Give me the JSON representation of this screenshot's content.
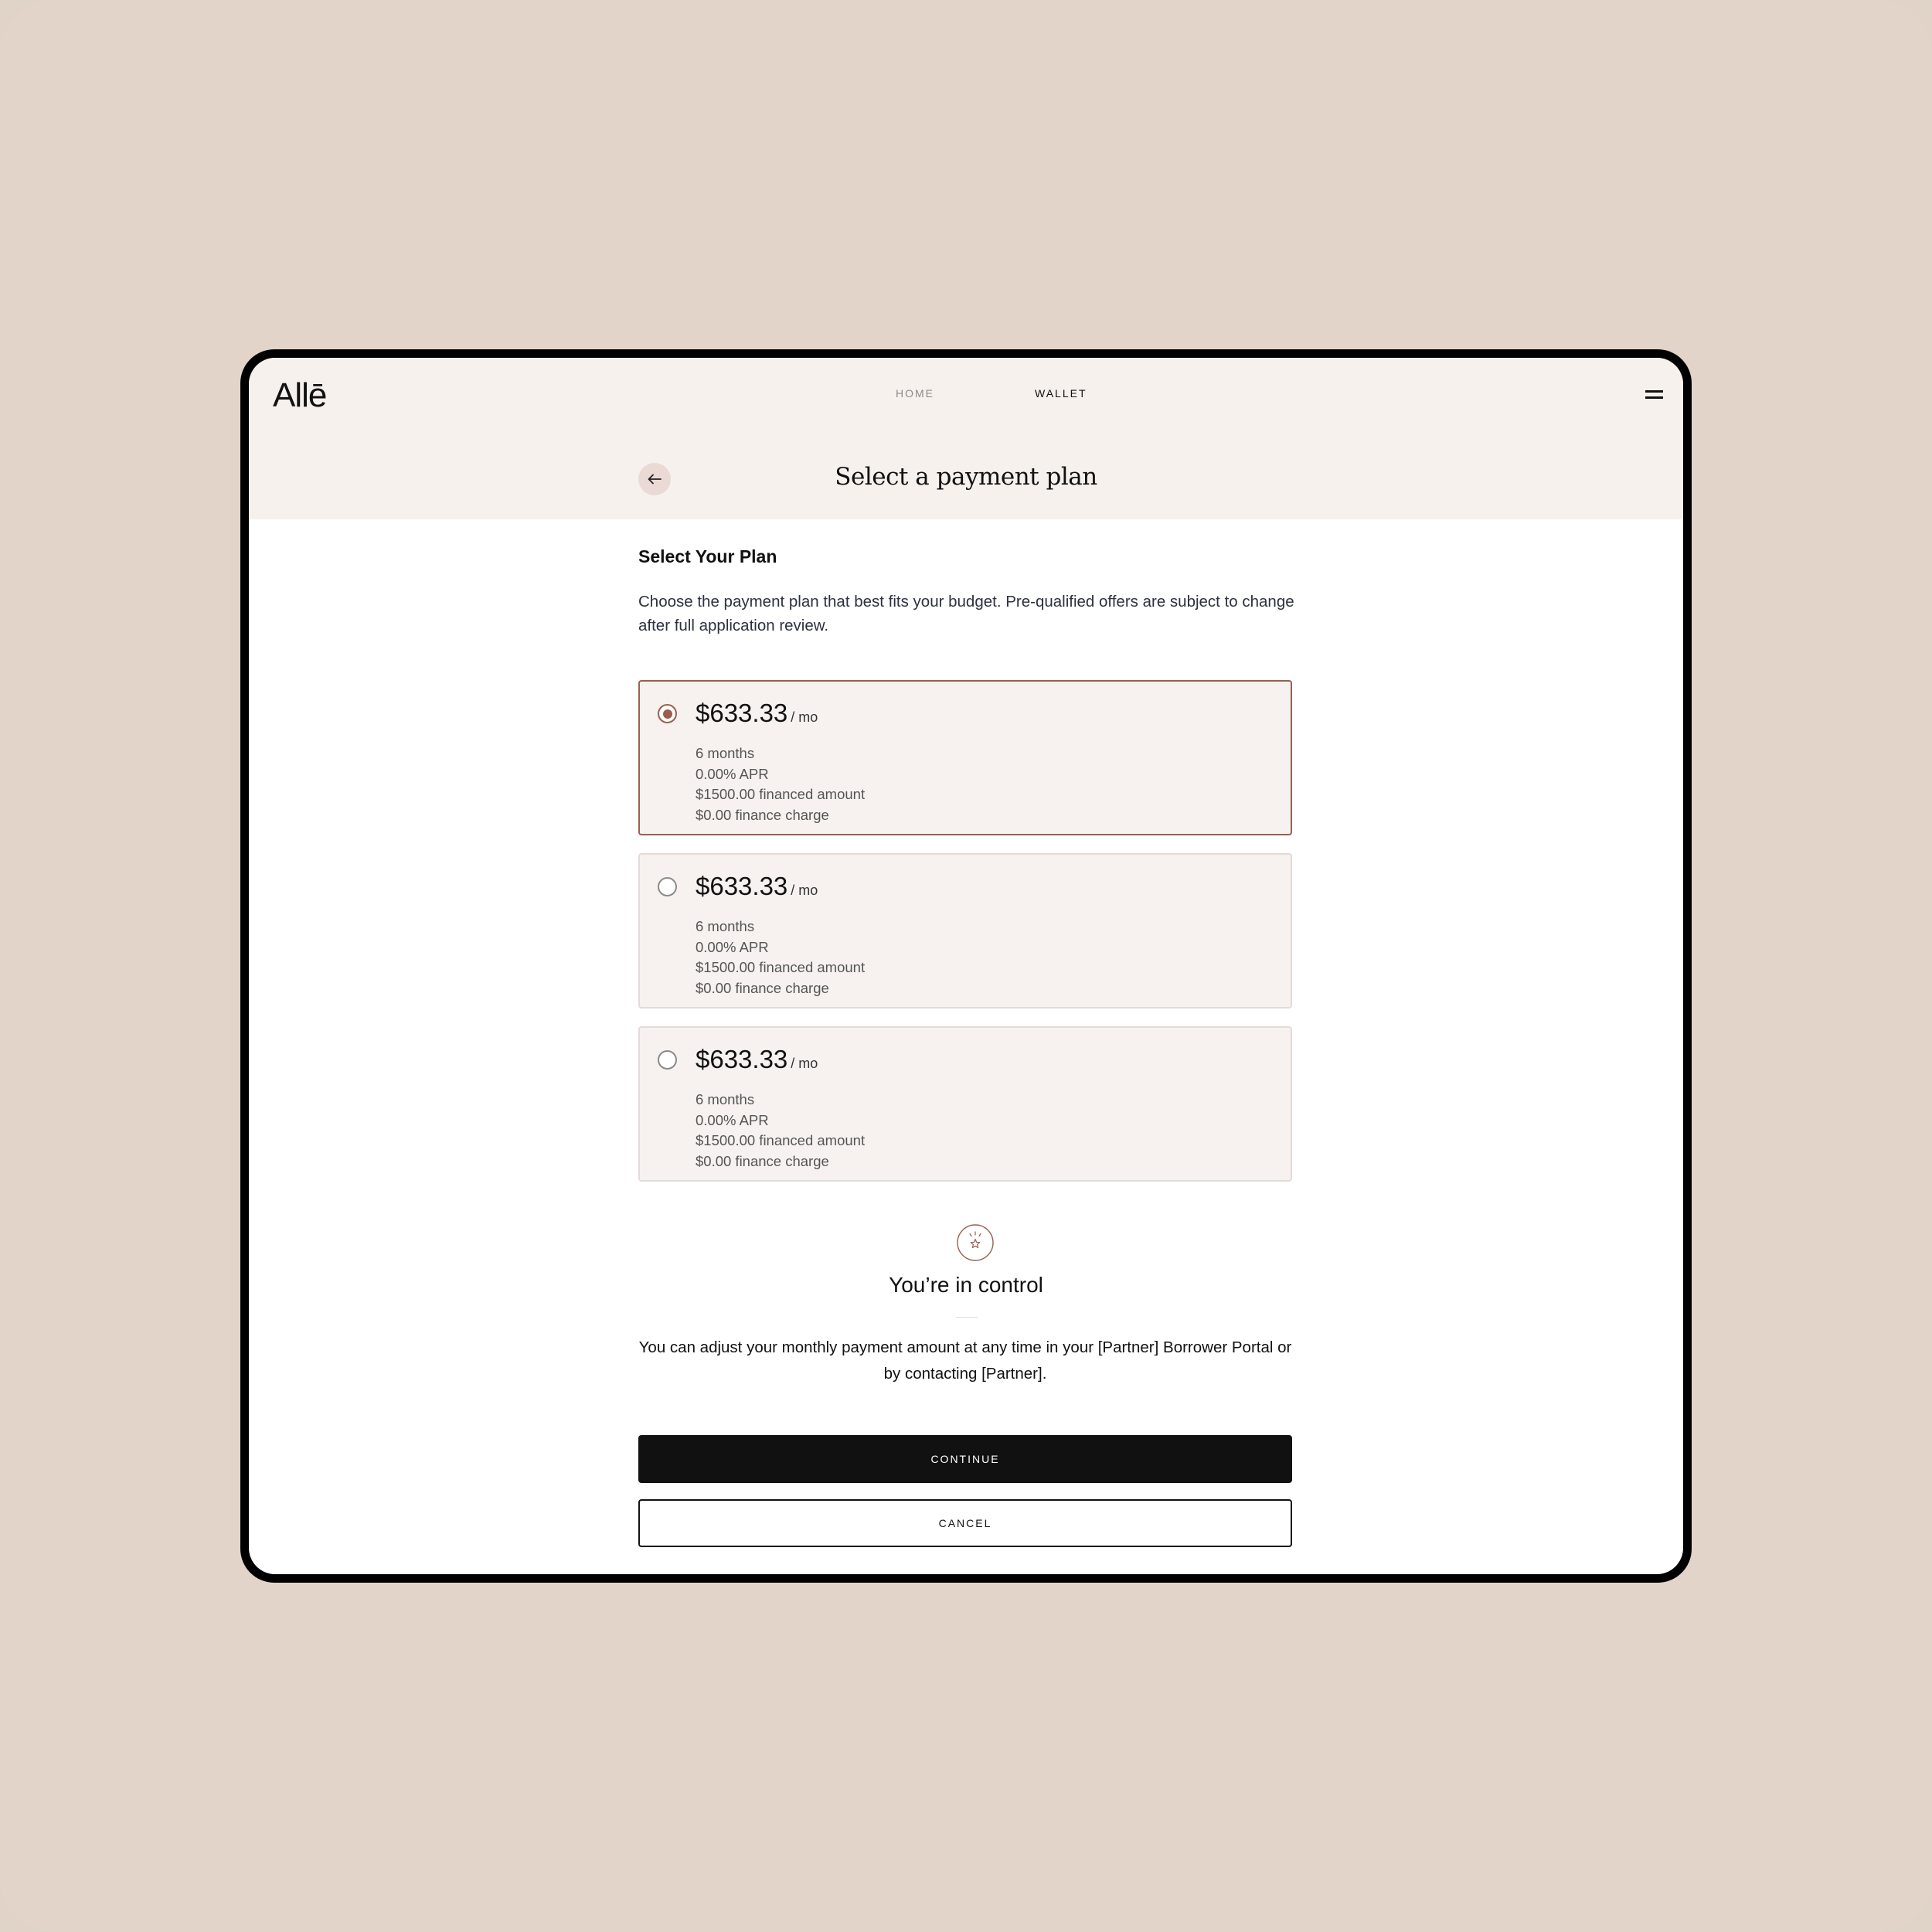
{
  "header": {
    "logo": "Allē",
    "nav": [
      {
        "label": "HOME"
      },
      {
        "label": "WALLET"
      }
    ],
    "menu_icon": "hamburger-icon"
  },
  "page": {
    "title": "Select a payment plan",
    "back_icon": "arrow-left-icon"
  },
  "plan_section": {
    "title": "Select Your Plan",
    "description": "Choose the payment plan that best fits your budget. Pre-qualified offers are subject to change after full application review.",
    "plans": [
      {
        "price": "$633.33",
        "unit": "/ mo",
        "term": "6 months",
        "apr": "0.00% APR",
        "financed": "$1500.00 financed amount",
        "charge": "$0.00 finance charge",
        "selected": true
      },
      {
        "price": "$633.33",
        "unit": "/ mo",
        "term": "6 months",
        "apr": "0.00% APR",
        "financed": "$1500.00 financed amount",
        "charge": "$0.00 finance charge",
        "selected": false
      },
      {
        "price": "$633.33",
        "unit": "/ mo",
        "term": "6 months",
        "apr": "0.00% APR",
        "financed": "$1500.00 financed amount",
        "charge": "$0.00 finance charge",
        "selected": false
      }
    ]
  },
  "control": {
    "icon": "star-badge-icon",
    "title": "You’re in control",
    "description": "You can adjust your monthly payment amount at any time in your [Partner] Borrower Portal or by contacting [Partner]."
  },
  "actions": {
    "continue_label": "CONTINUE",
    "cancel_label": "CANCEL"
  },
  "colors": {
    "background": "#e2d4c9",
    "header_band": "#f7f1ee",
    "accent": "#9a5f4f",
    "primary_button": "#111111"
  }
}
